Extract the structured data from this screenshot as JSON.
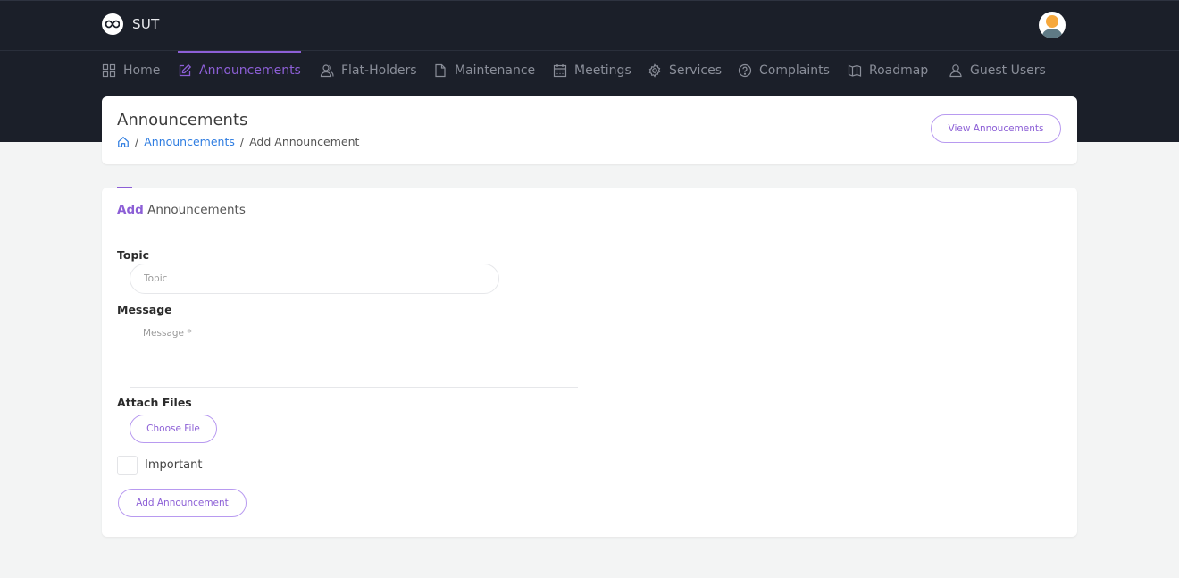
{
  "app": {
    "brand_name": "SUT",
    "brand_icon": "infinity-icon",
    "avatar_icon": "user-avatar-icon"
  },
  "colors": {
    "accent": "#8c5fd6",
    "link": "#2f7de1",
    "navbar_bg": "#1b1f29",
    "page_bg": "#f3f4f4"
  },
  "nav": {
    "items": [
      {
        "label": "Home",
        "icon": "grid-icon",
        "active": false
      },
      {
        "label": "Announcements",
        "icon": "edit-icon",
        "active": true
      },
      {
        "label": "Flat-Holders",
        "icon": "users-icon",
        "active": false
      },
      {
        "label": "Maintenance",
        "icon": "file-icon",
        "active": false
      },
      {
        "label": "Meetings",
        "icon": "calendar-icon",
        "active": false
      },
      {
        "label": "Services",
        "icon": "gear-icon",
        "active": false
      },
      {
        "label": "Complaints",
        "icon": "help-circle-icon",
        "active": false
      },
      {
        "label": "Roadmap",
        "icon": "map-icon",
        "active": false
      },
      {
        "label": "Guest Users",
        "icon": "user-icon",
        "active": false
      }
    ]
  },
  "header": {
    "title": "Announcements",
    "breadcrumb": {
      "home_icon": "home-icon",
      "separator": "/",
      "link": "Announcements",
      "current": "Add Announcement"
    },
    "view_button": "View Annoucements"
  },
  "form": {
    "title_accent": "Add",
    "title_rest": "Announcements",
    "topic": {
      "label": "Topic",
      "placeholder": "Topic",
      "value": ""
    },
    "message": {
      "label": "Message",
      "placeholder": "Message *",
      "value": ""
    },
    "attach": {
      "label": "Attach Files",
      "button": "Choose File"
    },
    "important": {
      "label": "Important",
      "checked": false
    },
    "submit_button": "Add Announcement"
  }
}
